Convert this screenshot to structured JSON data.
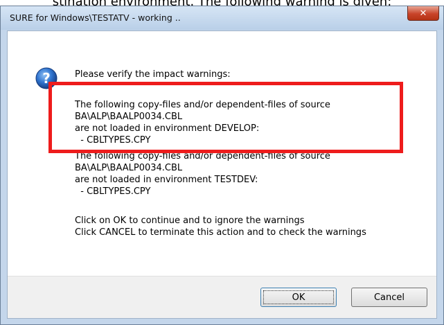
{
  "page": {
    "caption": "stination environment. The following warning is given:"
  },
  "window": {
    "title": "SURE for Windows\\TESTATV - working ..",
    "close_icon": "close-icon",
    "close_glyph": "✕"
  },
  "dialog": {
    "icon": "question-icon",
    "lines": [
      "Please verify the impact warnings:",
      "The following copy-files and/or dependent-files of source",
      "BA\\ALP\\BAALP0034.CBL",
      "are not loaded in environment DEVELOP:",
      "  - CBLTYPES.CPY",
      "The following copy-files and/or dependent-files of source",
      "BA\\ALP\\BAALP0034.CBL",
      "are not loaded in environment TESTDEV:",
      "  - CBLTYPES.CPY",
      "Click on OK  to continue and to ignore the warnings",
      "Click CANCEL to terminate this action and to check the warnings"
    ]
  },
  "buttons": {
    "ok_label": "OK",
    "cancel_label": "Cancel"
  },
  "colors": {
    "highlight": "#ee1c1c",
    "close_button": "#c8442a",
    "question_icon": "#1d5fb8"
  }
}
